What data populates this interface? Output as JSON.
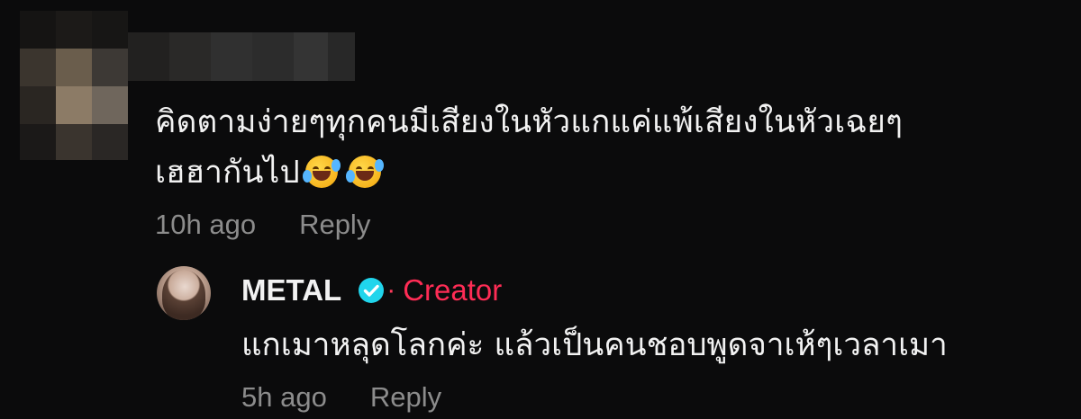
{
  "comment": {
    "text_line1": "คิดตามง่ายๆทุกคนมีเสียงในหัวแกแค่แพ้เสียงในหัวเฉยๆ",
    "text_line2": "เฮฮากันไป",
    "emoji": [
      "rolling-on-floor-laughing",
      "rolling-on-floor-laughing"
    ],
    "time": "10h ago",
    "reply_label": "Reply"
  },
  "reply": {
    "author": "METAL",
    "verified": true,
    "badge_separator": "·",
    "badge": "Creator",
    "text": "แกเมาหลุดโลกค่ะ แล้วเป็นคนชอบพูดจาเห้ๆเวลาเมา",
    "time": "5h ago",
    "reply_label": "Reply"
  },
  "colors": {
    "background": "#0b0b0c",
    "text": "#f2f2f2",
    "meta": "#8c8c8c",
    "creator": "#fe2c55",
    "verified": "#20d5ec"
  }
}
